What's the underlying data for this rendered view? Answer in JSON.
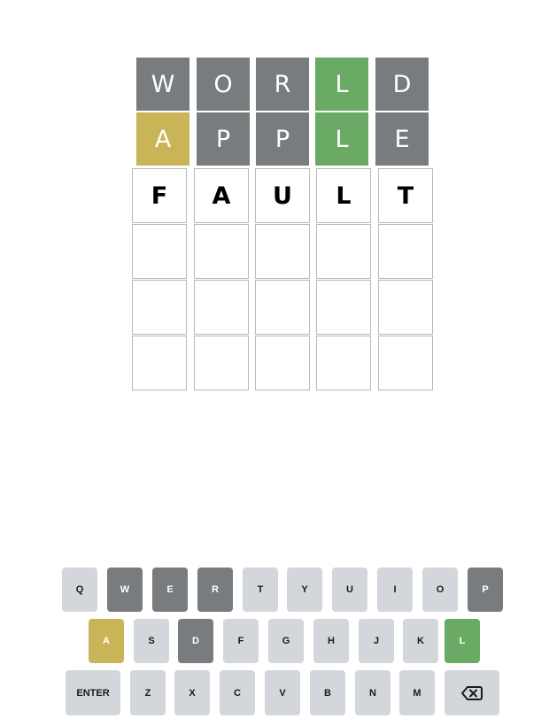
{
  "colors": {
    "absent": "#787c7e",
    "present": "#c9b458",
    "correct": "#6aaa64",
    "key_default": "#d3d6da",
    "empty_border": "#b9b9b9"
  },
  "board": {
    "rows": [
      {
        "letters": [
          "W",
          "O",
          "R",
          "L",
          "D"
        ],
        "states": [
          "absent",
          "absent",
          "absent",
          "correct",
          "absent"
        ]
      },
      {
        "letters": [
          "A",
          "P",
          "P",
          "L",
          "E"
        ],
        "states": [
          "present",
          "absent",
          "absent",
          "correct",
          "absent"
        ]
      },
      {
        "letters": [
          "F",
          "A",
          "U",
          "L",
          "T"
        ],
        "states": [
          "typed",
          "typed",
          "typed",
          "typed",
          "typed"
        ]
      },
      {
        "letters": [
          "",
          "",
          "",
          "",
          ""
        ],
        "states": [
          "empty",
          "empty",
          "empty",
          "empty",
          "empty"
        ]
      },
      {
        "letters": [
          "",
          "",
          "",
          "",
          ""
        ],
        "states": [
          "empty",
          "empty",
          "empty",
          "empty",
          "empty"
        ]
      },
      {
        "letters": [
          "",
          "",
          "",
          "",
          ""
        ],
        "states": [
          "empty",
          "empty",
          "empty",
          "empty",
          "empty"
        ]
      }
    ]
  },
  "keyboard": {
    "rows": [
      [
        {
          "label": "Q",
          "state": "unused"
        },
        {
          "label": "W",
          "state": "absent"
        },
        {
          "label": "E",
          "state": "absent"
        },
        {
          "label": "R",
          "state": "absent"
        },
        {
          "label": "T",
          "state": "unused"
        },
        {
          "label": "Y",
          "state": "unused"
        },
        {
          "label": "U",
          "state": "unused"
        },
        {
          "label": "I",
          "state": "unused"
        },
        {
          "label": "O",
          "state": "unused"
        },
        {
          "label": "P",
          "state": "absent"
        }
      ],
      [
        {
          "label": "A",
          "state": "present"
        },
        {
          "label": "S",
          "state": "unused"
        },
        {
          "label": "D",
          "state": "absent"
        },
        {
          "label": "F",
          "state": "unused"
        },
        {
          "label": "G",
          "state": "unused"
        },
        {
          "label": "H",
          "state": "unused"
        },
        {
          "label": "J",
          "state": "unused"
        },
        {
          "label": "K",
          "state": "unused"
        },
        {
          "label": "L",
          "state": "correct"
        }
      ],
      [
        {
          "label": "ENTER",
          "state": "unused"
        },
        {
          "label": "Z",
          "state": "unused"
        },
        {
          "label": "X",
          "state": "unused"
        },
        {
          "label": "C",
          "state": "unused"
        },
        {
          "label": "V",
          "state": "unused"
        },
        {
          "label": "B",
          "state": "unused"
        },
        {
          "label": "N",
          "state": "unused"
        },
        {
          "label": "M",
          "state": "unused"
        },
        {
          "label": "",
          "state": "unused",
          "icon": "backspace-icon"
        }
      ]
    ]
  }
}
